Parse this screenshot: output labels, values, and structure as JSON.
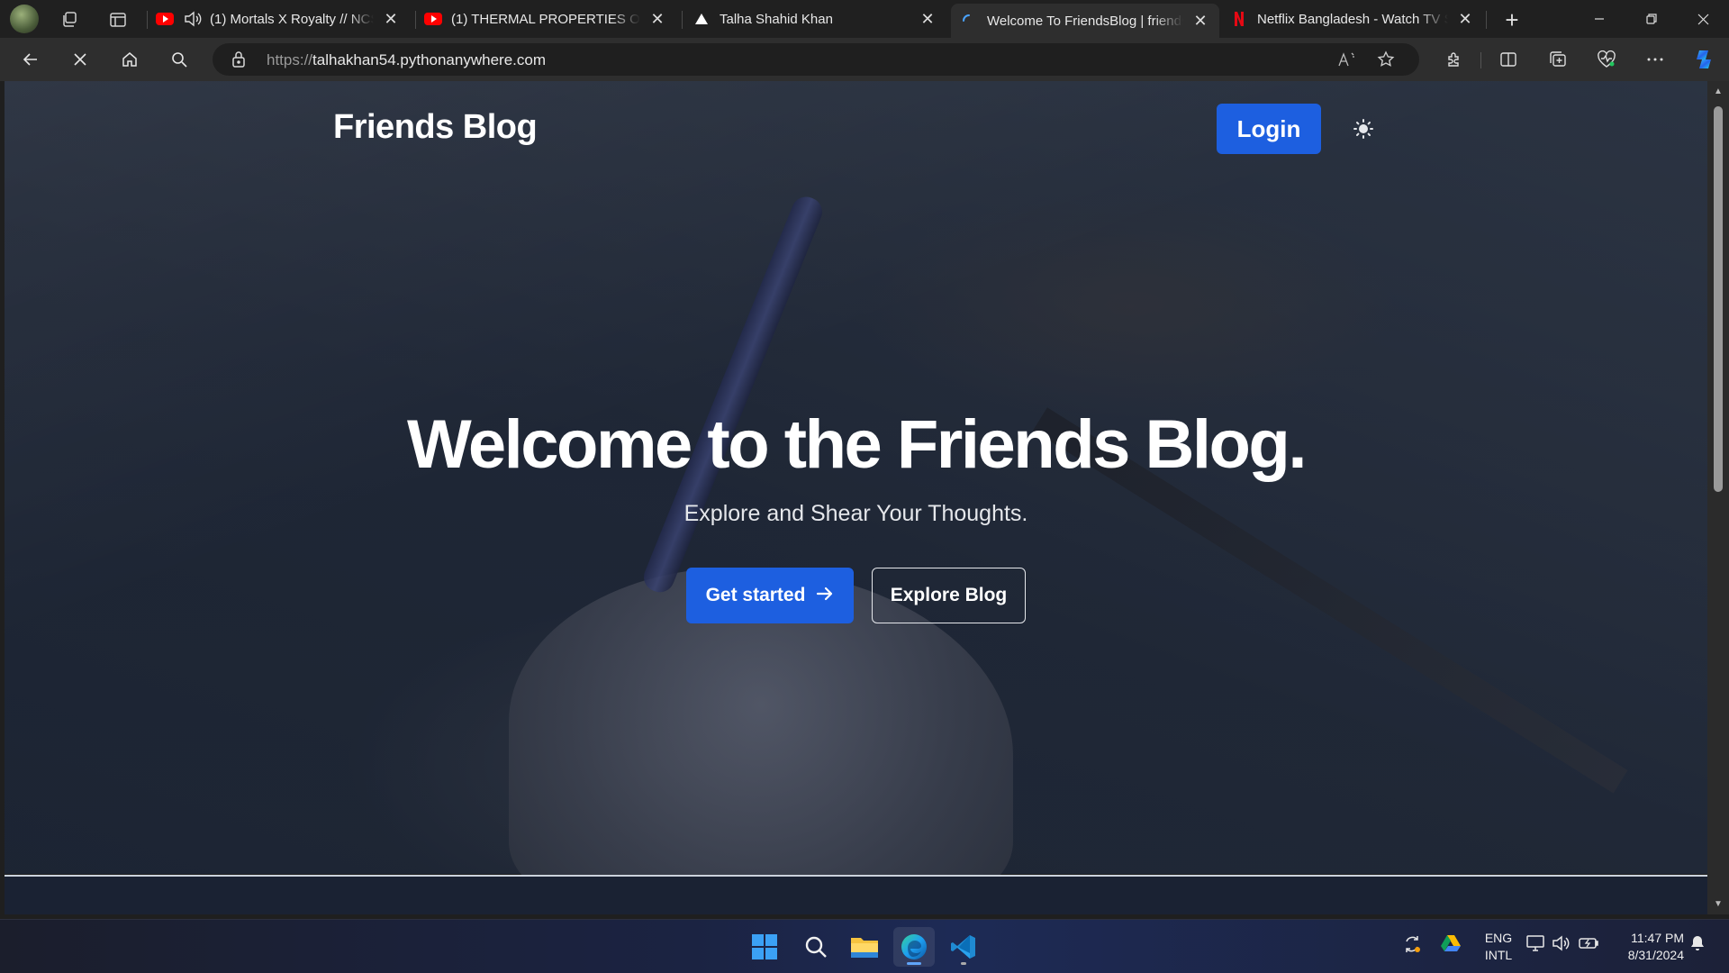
{
  "browser": {
    "tabs": [
      {
        "title": "(1) Mortals X Royalty // NCS",
        "favicon": "youtube-icon",
        "audio": true,
        "active": false
      },
      {
        "title": "(1) THERMAL PROPERTIES OF MA",
        "favicon": "youtube-icon",
        "audio": false,
        "active": false
      },
      {
        "title": "Talha Shahid Khan",
        "favicon": "vercel-icon",
        "audio": false,
        "active": false
      },
      {
        "title": "Welcome To FriendsBlog | friends",
        "favicon": "loading-icon",
        "audio": false,
        "active": true
      },
      {
        "title": "Netflix Bangladesh - Watch TV Sh",
        "favicon": "netflix-icon",
        "audio": false,
        "active": false
      }
    ],
    "address": {
      "scheme": "https://",
      "host": "talhakhan54.pythonanywhere.com"
    }
  },
  "page": {
    "brand": "Friends Blog",
    "login_label": "Login",
    "headline": "Welcome to the Friends Blog.",
    "subhead": "Explore and Shear Your Thoughts.",
    "primary_cta": "Get started",
    "secondary_cta": "Explore Blog"
  },
  "taskbar": {
    "lang_line1": "ENG",
    "lang_line2": "INTL",
    "time": "11:47 PM",
    "date": "8/31/2024"
  },
  "colors": {
    "accent": "#1d5fe0",
    "browser_chrome": "#202020",
    "toolbar": "#2e2e2e"
  }
}
